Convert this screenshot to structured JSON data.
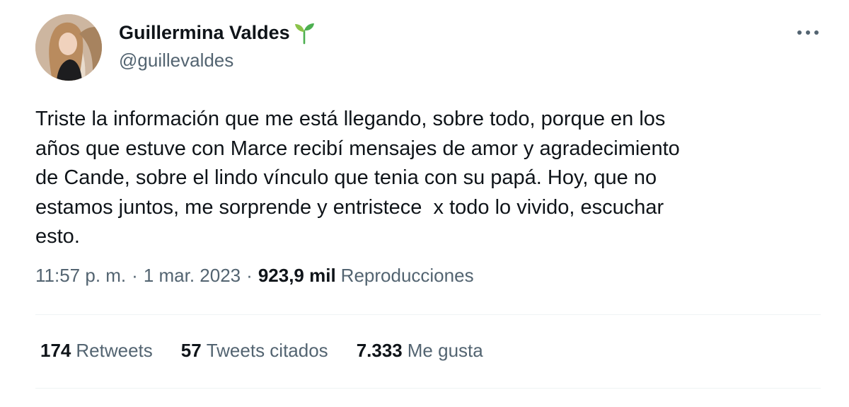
{
  "author": {
    "name": "Guillermina Valdes",
    "handle": "@guillevaldes",
    "badge_icon": "sprout-icon",
    "badge_color": "#4caf50"
  },
  "tweet": {
    "text": "Triste la información que me está llegando, sobre todo, porque en los\naños que estuve con Marce recibí mensajes de amor y agradecimiento\nde Cande, sobre el lindo vínculo que tenia con su papá. Hoy, que no\nestamos juntos, me sorprende y entristece  x todo lo vivido, escuchar\nesto.",
    "time": "11:57 p. m.",
    "separator": "·",
    "date": "1 mar. 2023",
    "views_count": "923,9 mil",
    "views_label": "Reproducciones"
  },
  "stats": [
    {
      "count": "174",
      "label": "Retweets"
    },
    {
      "count": "57",
      "label": "Tweets citados"
    },
    {
      "count": "7.333",
      "label": "Me gusta"
    }
  ],
  "colors": {
    "text_primary": "#0f1419",
    "text_secondary": "#536471",
    "divider": "#eff3f4"
  }
}
